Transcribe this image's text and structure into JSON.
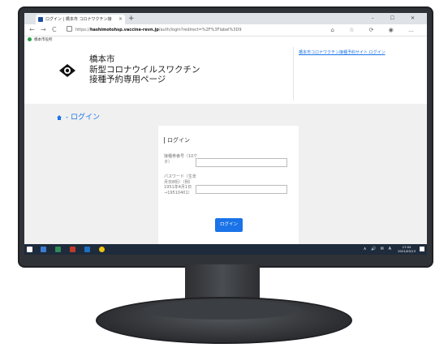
{
  "browser": {
    "tab_title": "ログイン | 橋本市 コロナワクチン接",
    "tab_close": "×",
    "new_tab": "+",
    "window_controls": "– ☐ ✕",
    "url_prefix": "https://",
    "url_host": "hashimotohsp.vaccine-revn.jp",
    "url_path": "/auth/login?redirect=%2F%3Flabel%3D9",
    "toolbar_icons": "⌂ ☆ ⟳ ◉ …",
    "bookmark": "橋本市役所"
  },
  "header": {
    "title_line1": "橋本市",
    "title_line2": "新型コロナウイルスワクチン",
    "title_line3": "接種予約専用ページ",
    "top_link": "橋本市コロナワクチン接種予約サイト ログイン"
  },
  "breadcrumb": {
    "label": "ログイン"
  },
  "login": {
    "title": "ログイン",
    "number_label": "接種券番号（10ケタ）",
    "password_label": "パスワード（生年月日8桁）（例）1951年4月1日→19510401）",
    "number_value": "",
    "password_value": "",
    "submit": "ログイン"
  },
  "taskbar": {
    "tray": "∧ 🔊 ✉ A",
    "time": "17:04",
    "date": "2021/05/13"
  },
  "colors": {
    "accent": "#1a73e8",
    "page_bg": "#f0f0f0",
    "taskbar": "#1e2b3c"
  }
}
